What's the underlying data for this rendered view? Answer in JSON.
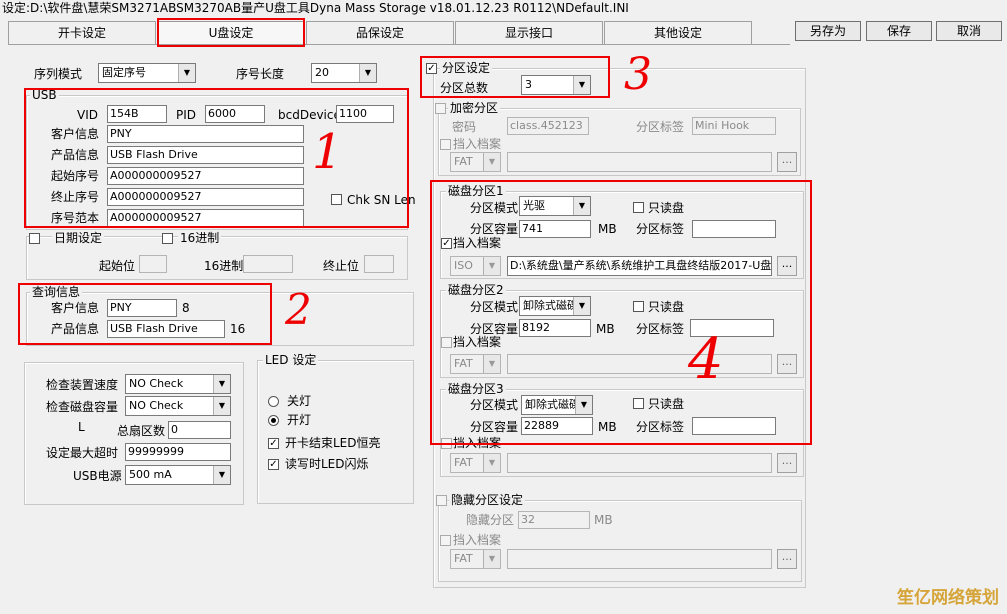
{
  "window": {
    "title": "设定:D:\\软件盘\\慧荣SM3271ABSM3270AB量产U盘工具Dyna Mass Storage v18.01.12.23 R0112\\NDefault.INI"
  },
  "tabs": [
    "开卡设定",
    "U盘设定",
    "品保设定",
    "显示接口",
    "其他设定"
  ],
  "buttons": {
    "save_as": "另存为",
    "save": "保存",
    "cancel": "取消"
  },
  "serial": {
    "mode_label": "序列模式",
    "mode_value": "固定序号",
    "length_label": "序号长度",
    "length_value": "20"
  },
  "usb": {
    "group": "USB",
    "vid_label": "VID",
    "vid": "154B",
    "pid_label": "PID",
    "pid": "6000",
    "bcd_label": "bcdDevice",
    "bcd": "1100",
    "customer_label": "客户信息",
    "customer": "PNY",
    "product_label": "产品信息",
    "product": "USB Flash Drive",
    "start_label": "起始序号",
    "start": "A000000009527",
    "end_label": "终止序号",
    "end": "A000000009527",
    "sample_label": "序号范本",
    "sample": "A000000009527",
    "chk_sn_len": "Chk SN Len"
  },
  "date": {
    "label": "日期设定",
    "hex_label": "16进制",
    "start_label": "起始位",
    "hex2_label": "16进制",
    "end_label": "终止位"
  },
  "query": {
    "group": "查询信息",
    "customer_label": "客户信息",
    "customer": "PNY",
    "customer_len": "8",
    "product_label": "产品信息",
    "product": "USB Flash Drive",
    "product_len": "16"
  },
  "check": {
    "speed_label": "检查装置速度",
    "speed": "NO Check",
    "capacity_label": "检查磁盘容量",
    "capacity": "NO Check",
    "l_label": "L",
    "sectors_label": "总扇区数",
    "sectors": "0",
    "timeout_label": "设定最大超时",
    "timeout": "99999999",
    "power_label": "USB电源",
    "power": "500 mA"
  },
  "led": {
    "group": "LED 设定",
    "off": "关灯",
    "on": "开灯",
    "opt1": "开卡结束LED恒亮",
    "opt2": "读写时LED闪烁"
  },
  "partition": {
    "label": "分区设定",
    "total_label": "分区总数",
    "total": "3"
  },
  "encrypt": {
    "label": "加密分区",
    "password_label": "密码",
    "password": "class.452123",
    "tag_label": "分区标签",
    "tag": "Mini Hook",
    "load_label": "挡入档案",
    "fs": "FAT"
  },
  "disks": [
    {
      "label": "磁盘分区1",
      "mode_label": "分区模式",
      "mode": "光驱",
      "readonly": "只读盘",
      "cap_label": "分区容量",
      "cap": "741",
      "unit": "MB",
      "tag_label": "分区标签",
      "load_label": "挡入档案",
      "fs": "ISO",
      "file": "D:\\系统盘\\量产系统\\系统维护工具盘终结版2017-U盘"
    },
    {
      "label": "磁盘分区2",
      "mode_label": "分区模式",
      "mode": "卸除式磁碟",
      "readonly": "只读盘",
      "cap_label": "分区容量",
      "cap": "8192",
      "unit": "MB",
      "tag_label": "分区标签",
      "load_label": "挡入档案",
      "fs": "FAT",
      "file": ""
    },
    {
      "label": "磁盘分区3",
      "mode_label": "分区模式",
      "mode": "卸除式磁碟",
      "readonly": "只读盘",
      "cap_label": "分区容量",
      "cap": "22889",
      "unit": "MB",
      "tag_label": "分区标签",
      "load_label": "挡入档案",
      "fs": "FAT",
      "file": ""
    }
  ],
  "hidden": {
    "label": "隐藏分区设定",
    "part_label": "隐藏分区",
    "part": "32",
    "unit": "MB",
    "load_label": "挡入档案",
    "fs": "FAT"
  },
  "annotations": [
    "1",
    "2",
    "3",
    "4"
  ],
  "watermark": "笙亿网络策划"
}
